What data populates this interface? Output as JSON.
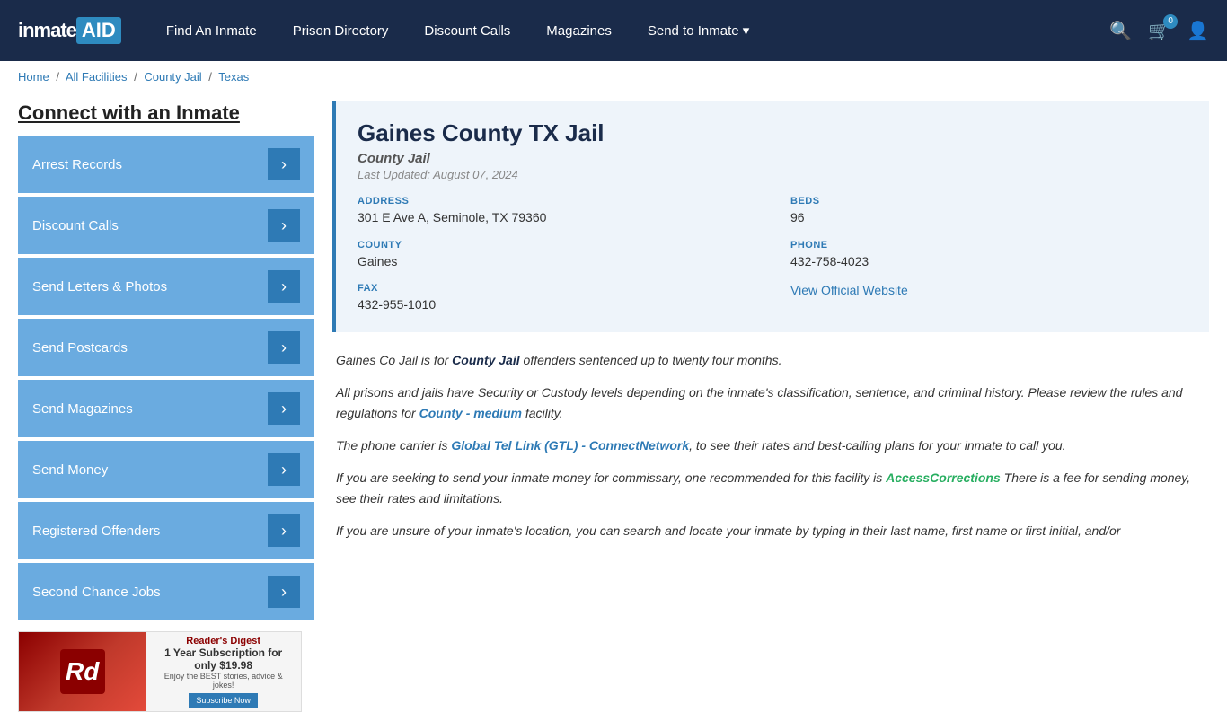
{
  "navbar": {
    "logo": "inmate",
    "logo_aid": "AID",
    "links": [
      {
        "label": "Find An Inmate",
        "id": "find-inmate"
      },
      {
        "label": "Prison Directory",
        "id": "prison-directory"
      },
      {
        "label": "Discount Calls",
        "id": "discount-calls"
      },
      {
        "label": "Magazines",
        "id": "magazines"
      },
      {
        "label": "Send to Inmate ▾",
        "id": "send-to-inmate"
      }
    ],
    "cart_count": "0",
    "search_title": "Search",
    "cart_title": "Cart",
    "user_title": "Account"
  },
  "breadcrumb": {
    "home": "Home",
    "all_facilities": "All Facilities",
    "county_jail": "County Jail",
    "texas": "Texas",
    "sep": "/"
  },
  "sidebar": {
    "title": "Connect with an Inmate",
    "buttons": [
      {
        "label": "Arrest Records",
        "id": "arrest-records"
      },
      {
        "label": "Discount Calls",
        "id": "discount-calls-btn"
      },
      {
        "label": "Send Letters & Photos",
        "id": "send-letters"
      },
      {
        "label": "Send Postcards",
        "id": "send-postcards"
      },
      {
        "label": "Send Magazines",
        "id": "send-magazines"
      },
      {
        "label": "Send Money",
        "id": "send-money"
      },
      {
        "label": "Registered Offenders",
        "id": "registered-offenders"
      },
      {
        "label": "Second Chance Jobs",
        "id": "second-chance-jobs"
      }
    ]
  },
  "facility": {
    "name": "Gaines County TX Jail",
    "type": "County Jail",
    "last_updated": "Last Updated: August 07, 2024",
    "address_label": "ADDRESS",
    "address_value": "301 E Ave A, Seminole, TX 79360",
    "beds_label": "BEDS",
    "beds_value": "96",
    "county_label": "COUNTY",
    "county_value": "Gaines",
    "phone_label": "PHONE",
    "phone_value": "432-758-4023",
    "fax_label": "FAX",
    "fax_value": "432-955-1010",
    "official_website_label": "View Official Website",
    "official_website_url": "#"
  },
  "description": {
    "para1": "Gaines Co Jail is for ",
    "para1_link": "County Jail",
    "para1_rest": " offenders sentenced up to twenty four months.",
    "para2": "All prisons and jails have Security or Custody levels depending on the inmate's classification, sentence, and criminal history. Please review the rules and regulations for ",
    "para2_link": "County - medium",
    "para2_rest": " facility.",
    "para3": "The phone carrier is ",
    "para3_link": "Global Tel Link (GTL) - ConnectNetwork",
    "para3_rest": ", to see their rates and best-calling plans for your inmate to call you.",
    "para4": "If you are seeking to send your inmate money for commissary, one recommended for this facility is ",
    "para4_link": "AccessCorrections",
    "para4_rest": " There is a fee for sending money, see their rates and limitations.",
    "para5": "If you are unsure of your inmate's location, you can search and locate your inmate by typing in their last name, first name or first initial, and/or"
  },
  "ad": {
    "logo": "Rd",
    "title": "Reader's Digest",
    "price": "1 Year Subscription for only $19.98",
    "subtitle": "Enjoy the BEST stories, advice & jokes!",
    "button": "Subscribe Now"
  }
}
